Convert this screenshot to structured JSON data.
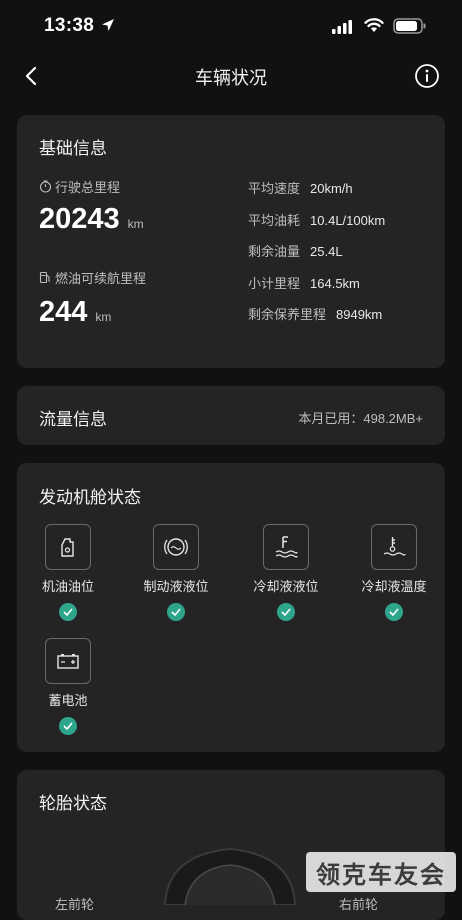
{
  "status_bar": {
    "time": "13:38"
  },
  "header": {
    "title": "车辆状况"
  },
  "basic": {
    "title": "基础信息",
    "total_mileage_label": "行驶总里程",
    "total_mileage_value": "20243",
    "total_mileage_unit": "km",
    "range_label": "燃油可续航里程",
    "range_value": "244",
    "range_unit": "km",
    "stats": [
      {
        "label": "平均速度",
        "value": "20km/h"
      },
      {
        "label": "平均油耗",
        "value": "10.4L/100km"
      },
      {
        "label": "剩余油量",
        "value": "25.4L"
      },
      {
        "label": "小计里程",
        "value": "164.5km"
      },
      {
        "label": "剩余保养里程",
        "value": "8949km"
      }
    ]
  },
  "traffic": {
    "title": "流量信息",
    "usage": "本月已用：498.2MB+"
  },
  "engine": {
    "title": "发动机舱状态",
    "items": [
      {
        "label": "机油油位",
        "icon": "oil-can-icon",
        "status": "ok"
      },
      {
        "label": "制动液液位",
        "icon": "brake-fluid-icon",
        "status": "ok"
      },
      {
        "label": "冷却液液位",
        "icon": "coolant-level-icon",
        "status": "ok"
      },
      {
        "label": "冷却液温度",
        "icon": "coolant-temp-icon",
        "status": "ok"
      },
      {
        "label": "蓄电池",
        "icon": "battery-icon",
        "status": "ok"
      }
    ],
    "accent": "#2fa58c"
  },
  "tires": {
    "title": "轮胎状态",
    "left_label": "左前轮",
    "right_label": "右前轮"
  },
  "watermark": "领克车友会"
}
